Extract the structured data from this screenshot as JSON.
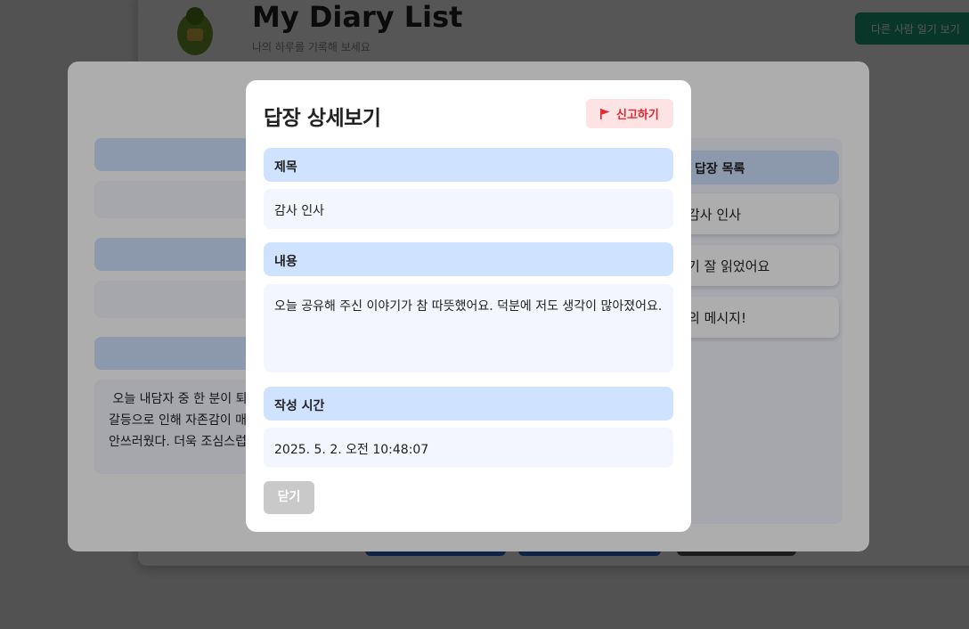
{
  "background_page": {
    "title": "My Diary List",
    "subtitle": "나의 하루를 기록해 보세요",
    "top_button_label": "다른 사람 일기 보기"
  },
  "outer_modal": {
    "content_text": " 오늘 내담자 중 한 분이 퇴사\n갈등으로 인해 자존감이 매우\n안쓰러웠다. 더욱 조심스럽게",
    "reply_list": {
      "header": "답장 목록",
      "items": [
        "감사 인사",
        "기 잘 읽었어요",
        "의 메시지!"
      ]
    }
  },
  "detail_modal": {
    "title": "답장 상세보기",
    "report_button_label": "신고하기",
    "report_icon": "flag-icon",
    "report_color": "#e0282e",
    "sections": {
      "title_label": "제목",
      "title_value": "감사 인사",
      "content_label": "내용",
      "content_value": "오늘 공유해 주신 이야기가 참 따뜻했어요. 덕분에 저도 생각이 많아졌어요.",
      "time_label": "작성 시간",
      "time_value": "2025. 5. 2. 오전 10:48:07"
    },
    "close_button_label": "닫기"
  }
}
